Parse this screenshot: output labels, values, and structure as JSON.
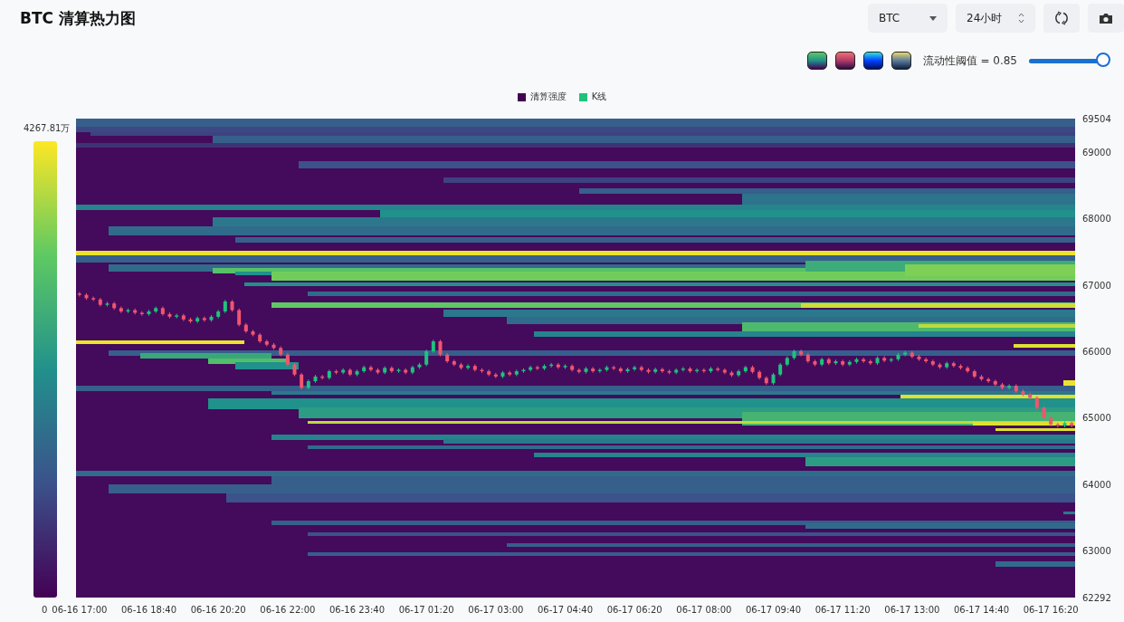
{
  "title": "BTC 清算热力图",
  "controls": {
    "symbol_select": {
      "value": "BTC"
    },
    "range_select": {
      "value": "24小时"
    }
  },
  "threshold": {
    "label": "流动性阈值 = 0.85",
    "level": 0.92
  },
  "chart": {
    "legend": [
      {
        "label": "清算强度",
        "color": "#440154"
      },
      {
        "label": "K线",
        "color": "#1fc27d"
      }
    ],
    "color_scale": {
      "max_label": "4267.81万",
      "min_label": "0"
    },
    "chart_data": {
      "type": "candlestick",
      "ylim": [
        62292,
        69504
      ],
      "categories": [
        "06-16 17:00",
        null,
        null,
        null,
        null,
        null,
        null,
        null,
        null,
        null,
        "06-16 18:40",
        null,
        null,
        null,
        null,
        null,
        null,
        null,
        null,
        null,
        "06-16 20:20",
        null,
        null,
        null,
        null,
        null,
        null,
        null,
        null,
        null,
        "06-16 22:00",
        null,
        null,
        null,
        null,
        null,
        null,
        null,
        null,
        null,
        "06-16 23:40",
        null,
        null,
        null,
        null,
        null,
        null,
        null,
        null,
        null,
        "06-17 01:20",
        null,
        null,
        null,
        null,
        null,
        null,
        null,
        null,
        null,
        "06-17 03:00",
        null,
        null,
        null,
        null,
        null,
        null,
        null,
        null,
        null,
        "06-17 04:40",
        null,
        null,
        null,
        null,
        null,
        null,
        null,
        null,
        null,
        "06-17 06:20",
        null,
        null,
        null,
        null,
        null,
        null,
        null,
        null,
        null,
        "06-17 08:00",
        null,
        null,
        null,
        null,
        null,
        null,
        null,
        null,
        null,
        "06-17 09:40",
        null,
        null,
        null,
        null,
        null,
        null,
        null,
        null,
        null,
        "06-17 11:20",
        null,
        null,
        null,
        null,
        null,
        null,
        null,
        null,
        null,
        "06-17 13:00",
        null,
        null,
        null,
        null,
        null,
        null,
        null,
        null,
        null,
        "06-17 14:40",
        null,
        null,
        null,
        null,
        null,
        null,
        null,
        null,
        null,
        "06-17 16:20",
        null,
        null,
        null
      ],
      "yticks": [
        69504,
        69000,
        68000,
        67000,
        66000,
        65000,
        64000,
        63000,
        62292
      ],
      "ohlc": [
        [
          66870,
          66895,
          66825,
          66850
        ],
        [
          66850,
          66875,
          66775,
          66800
        ],
        [
          66800,
          66825,
          66755,
          66780
        ],
        [
          66780,
          66805,
          66675,
          66700
        ],
        [
          66700,
          66745,
          66675,
          66720
        ],
        [
          66720,
          66745,
          66625,
          66650
        ],
        [
          66650,
          66675,
          66575,
          66600
        ],
        [
          66600,
          66645,
          66575,
          66620
        ],
        [
          66620,
          66645,
          66555,
          66580
        ],
        [
          66580,
          66605,
          66535,
          66560
        ],
        [
          66560,
          66625,
          66535,
          66600
        ],
        [
          66600,
          66675,
          66575,
          66650
        ],
        [
          66650,
          66675,
          66535,
          66560
        ],
        [
          66560,
          66585,
          66495,
          66520
        ],
        [
          66520,
          66565,
          66495,
          66540
        ],
        [
          66540,
          66565,
          66455,
          66480
        ],
        [
          66480,
          66505,
          66425,
          66450
        ],
        [
          66450,
          66525,
          66425,
          66500
        ],
        [
          66500,
          66525,
          66445,
          66470
        ],
        [
          66470,
          66545,
          66445,
          66520
        ],
        [
          66520,
          66625,
          66495,
          66600
        ],
        [
          66600,
          66775,
          66575,
          66750
        ],
        [
          66750,
          66775,
          66595,
          66620
        ],
        [
          66620,
          66645,
          66375,
          66400
        ],
        [
          66400,
          66425,
          66275,
          66300
        ],
        [
          66300,
          66325,
          66225,
          66250
        ],
        [
          66250,
          66275,
          66125,
          66150
        ],
        [
          66150,
          66175,
          66075,
          66100
        ],
        [
          66100,
          66125,
          66025,
          66050
        ],
        [
          66050,
          66075,
          65925,
          65950
        ],
        [
          65950,
          65975,
          65775,
          65800
        ],
        [
          65800,
          65825,
          65625,
          65650
        ],
        [
          65650,
          65675,
          65425,
          65450
        ],
        [
          65450,
          65575,
          65425,
          65550
        ],
        [
          65550,
          65645,
          65525,
          65620
        ],
        [
          65620,
          65645,
          65575,
          65600
        ],
        [
          65600,
          65725,
          65575,
          65700
        ],
        [
          65700,
          65725,
          65655,
          65680
        ],
        [
          65680,
          65745,
          65655,
          65720
        ],
        [
          65720,
          65745,
          65625,
          65650
        ],
        [
          65650,
          65725,
          65625,
          65700
        ],
        [
          65700,
          65785,
          65675,
          65760
        ],
        [
          65760,
          65785,
          65695,
          65720
        ],
        [
          65720,
          65745,
          65655,
          65680
        ],
        [
          65680,
          65775,
          65655,
          65750
        ],
        [
          65750,
          65775,
          65675,
          65700
        ],
        [
          65700,
          65745,
          65675,
          65720
        ],
        [
          65720,
          65745,
          65655,
          65680
        ],
        [
          65680,
          65785,
          65655,
          65760
        ],
        [
          65760,
          65825,
          65735,
          65800
        ],
        [
          65800,
          66025,
          65775,
          66000
        ],
        [
          66000,
          66175,
          65975,
          66150
        ],
        [
          66150,
          66175,
          65925,
          65950
        ],
        [
          65950,
          65975,
          65825,
          65850
        ],
        [
          65850,
          65875,
          65775,
          65800
        ],
        [
          65800,
          65825,
          65725,
          65750
        ],
        [
          65750,
          65805,
          65725,
          65780
        ],
        [
          65780,
          65805,
          65695,
          65720
        ],
        [
          65720,
          65745,
          65675,
          65700
        ],
        [
          65700,
          65725,
          65625,
          65650
        ],
        [
          65650,
          65675,
          65595,
          65620
        ],
        [
          65620,
          65705,
          65595,
          65680
        ],
        [
          65680,
          65705,
          65625,
          65650
        ],
        [
          65650,
          65725,
          65625,
          65700
        ],
        [
          65700,
          65745,
          65675,
          65720
        ],
        [
          65720,
          65785,
          65695,
          65760
        ],
        [
          65760,
          65785,
          65715,
          65740
        ],
        [
          65740,
          65805,
          65715,
          65780
        ],
        [
          65780,
          65825,
          65755,
          65800
        ],
        [
          65800,
          65825,
          65735,
          65760
        ],
        [
          65760,
          65805,
          65735,
          65780
        ],
        [
          65780,
          65805,
          65695,
          65720
        ],
        [
          65720,
          65745,
          65665,
          65690
        ],
        [
          65690,
          65765,
          65665,
          65740
        ],
        [
          65740,
          65765,
          65675,
          65700
        ],
        [
          65700,
          65745,
          65675,
          65720
        ],
        [
          65720,
          65785,
          65695,
          65760
        ],
        [
          65760,
          65785,
          65715,
          65740
        ],
        [
          65740,
          65765,
          65675,
          65700
        ],
        [
          65700,
          65755,
          65675,
          65730
        ],
        [
          65730,
          65785,
          65705,
          65760
        ],
        [
          65760,
          65785,
          65695,
          65720
        ],
        [
          65720,
          65745,
          65665,
          65690
        ],
        [
          65690,
          65755,
          65665,
          65730
        ],
        [
          65730,
          65755,
          65675,
          65700
        ],
        [
          65700,
          65725,
          65655,
          65680
        ],
        [
          65680,
          65745,
          65655,
          65720
        ],
        [
          65720,
          65765,
          65695,
          65740
        ],
        [
          65740,
          65765,
          65675,
          65700
        ],
        [
          65700,
          65745,
          65675,
          65720
        ],
        [
          65720,
          65745,
          65675,
          65700
        ],
        [
          65700,
          65765,
          65675,
          65740
        ],
        [
          65740,
          65765,
          65695,
          65720
        ],
        [
          65720,
          65745,
          65655,
          65680
        ],
        [
          65680,
          65705,
          65615,
          65640
        ],
        [
          65640,
          65725,
          65615,
          65700
        ],
        [
          65700,
          65785,
          65675,
          65760
        ],
        [
          65760,
          65785,
          65665,
          65690
        ],
        [
          65690,
          65715,
          65575,
          65600
        ],
        [
          65600,
          65625,
          65495,
          65520
        ],
        [
          65520,
          65675,
          65495,
          65650
        ],
        [
          65650,
          65825,
          65625,
          65800
        ],
        [
          65800,
          65925,
          65775,
          65900
        ],
        [
          65900,
          66025,
          65875,
          66000
        ],
        [
          66000,
          66025,
          65925,
          65950
        ],
        [
          65950,
          65975,
          65825,
          65850
        ],
        [
          65850,
          65875,
          65775,
          65800
        ],
        [
          65800,
          65905,
          65775,
          65880
        ],
        [
          65880,
          65905,
          65795,
          65820
        ],
        [
          65820,
          65875,
          65795,
          65850
        ],
        [
          65850,
          65875,
          65775,
          65800
        ],
        [
          65800,
          65865,
          65775,
          65840
        ],
        [
          65840,
          65905,
          65815,
          65880
        ],
        [
          65880,
          65905,
          65825,
          65850
        ],
        [
          65850,
          65875,
          65795,
          65820
        ],
        [
          65820,
          65925,
          65795,
          65900
        ],
        [
          65900,
          65925,
          65835,
          65860
        ],
        [
          65860,
          65905,
          65835,
          65880
        ],
        [
          65880,
          65975,
          65855,
          65950
        ],
        [
          65950,
          66005,
          65925,
          65980
        ],
        [
          65980,
          66005,
          65895,
          65920
        ],
        [
          65920,
          65945,
          65855,
          65880
        ],
        [
          65880,
          65905,
          65825,
          65850
        ],
        [
          65850,
          65875,
          65775,
          65800
        ],
        [
          65800,
          65825,
          65735,
          65760
        ],
        [
          65760,
          65845,
          65735,
          65820
        ],
        [
          65820,
          65845,
          65755,
          65780
        ],
        [
          65780,
          65805,
          65725,
          65750
        ],
        [
          65750,
          65775,
          65675,
          65700
        ],
        [
          65700,
          65725,
          65595,
          65620
        ],
        [
          65620,
          65645,
          65555,
          65580
        ],
        [
          65580,
          65605,
          65525,
          65550
        ],
        [
          65550,
          65575,
          65475,
          65500
        ],
        [
          65500,
          65525,
          65425,
          65450
        ],
        [
          65450,
          65505,
          65425,
          65480
        ],
        [
          65480,
          65505,
          65375,
          65400
        ],
        [
          65400,
          65425,
          65325,
          65350
        ],
        [
          65350,
          65375,
          65275,
          65300
        ],
        [
          65300,
          65325,
          65125,
          65150
        ],
        [
          65150,
          65175,
          64975,
          65000
        ],
        [
          65000,
          65025,
          64875,
          64900
        ],
        [
          64900,
          64925,
          64855,
          64880
        ],
        [
          64880,
          64945,
          64855,
          64920
        ],
        [
          64920,
          64945,
          64855,
          64880
        ]
      ]
    }
  }
}
